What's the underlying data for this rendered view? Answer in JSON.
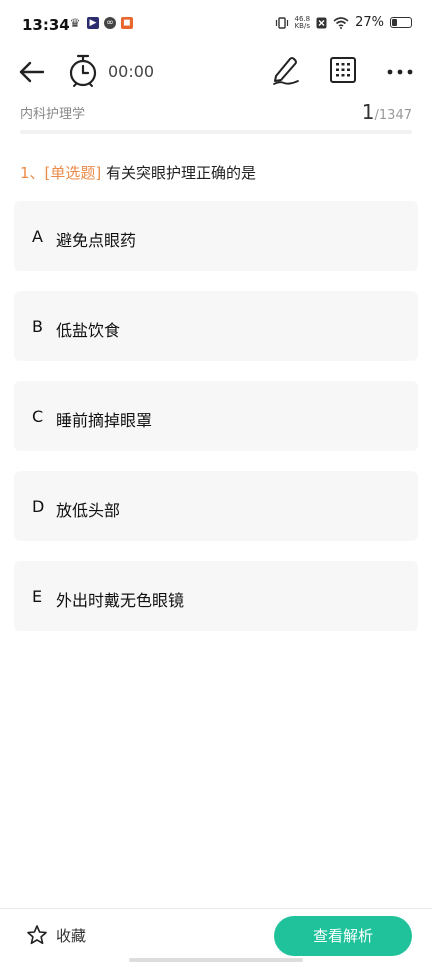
{
  "status_bar": {
    "time": "13:34",
    "net_speed_top": "46.8",
    "net_speed_unit": "KB/s",
    "battery_percent": "27%",
    "battery_level": 0.27
  },
  "toolbar": {
    "timer_value": "00:00"
  },
  "subject": {
    "name": "内科护理学",
    "current": "1",
    "total": "/1347"
  },
  "question": {
    "number": "1、",
    "type": "[单选题]",
    "text": " 有关突眼护理正确的是"
  },
  "options": [
    {
      "letter": "A",
      "text": "避免点眼药"
    },
    {
      "letter": "B",
      "text": "低盐饮食"
    },
    {
      "letter": "C",
      "text": "睡前摘掉眼罩"
    },
    {
      "letter": "D",
      "text": "放低头部"
    },
    {
      "letter": "E",
      "text": "外出时戴无色眼镜"
    }
  ],
  "bottom_bar": {
    "favorite_label": "收藏",
    "analysis_label": "查看解析",
    "accent_color": "#1fc29a"
  }
}
